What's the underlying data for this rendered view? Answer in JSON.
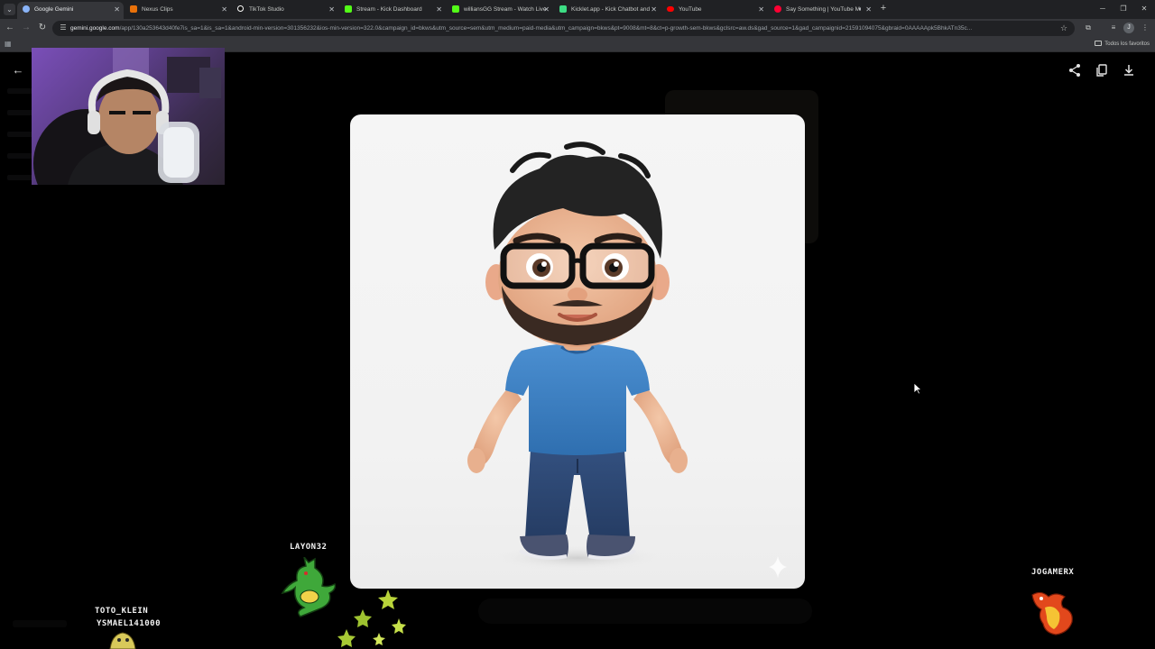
{
  "browser": {
    "tabs": [
      {
        "title": "Google Gemini",
        "favicon": "gemini-icon",
        "color": "#8ab4f8",
        "active": true
      },
      {
        "title": "Nexus Clips",
        "favicon": "nexus-clips-icon",
        "color": "#e8710a",
        "active": false
      },
      {
        "title": "TikTok Studio",
        "favicon": "tiktok-icon",
        "color": "#ffffff",
        "active": false
      },
      {
        "title": "Stream - Kick Dashboard",
        "favicon": "kick-icon",
        "color": "#53fc18",
        "active": false
      },
      {
        "title": "williansGG Stream - Watch Live",
        "favicon": "kick-icon",
        "color": "#53fc18",
        "active": false
      },
      {
        "title": "Kicklet.app - Kick Chatbot and",
        "favicon": "kicklet-icon",
        "color": "#3ddc84",
        "active": false
      },
      {
        "title": "YouTube",
        "favicon": "youtube-icon",
        "color": "#ff0000",
        "active": false
      },
      {
        "title": "Say Something | YouTube M",
        "favicon": "youtube-music-icon",
        "color": "#ff0033",
        "active": false,
        "audio": true
      }
    ],
    "url_host": "gemini.google.com",
    "url_path": "/app/130a253643d40fe7is_sa=1&is_sa=1&android-min-version=301356232&ios-min-version=322.0&campaign_id=bkws&utm_source=sem&utm_medium=paid-media&utm_campaign=bkws&pt=9008&mt=8&ct=p-growth-sem-bkws&gclsrc=aw.ds&gad_source=1&gad_campaignid=21591094075&gbraid=0AAAAApk5BhkATn35c...",
    "bookmarks_bar": {
      "all_bookmarks_label": "Todos los favoritos"
    }
  },
  "gemini": {
    "image_alt": "3D cartoon character with black glasses, beard, blue t-shirt and jeans",
    "icons": [
      "arrow-back-icon",
      "share-icon",
      "copy-icon",
      "download-icon"
    ]
  },
  "overlay": {
    "viewers": [
      {
        "name": "LAYON32"
      },
      {
        "name": "JOGAMERX"
      },
      {
        "name": "TOTO_KLEIN"
      },
      {
        "name": "YSMAEL141000"
      }
    ]
  },
  "colors": {
    "background": "#000000",
    "chrome_dark": "#202124",
    "chrome_mid": "#35363a",
    "shirt_blue": "#3d7fc2",
    "jeans_blue": "#2e4a78"
  }
}
